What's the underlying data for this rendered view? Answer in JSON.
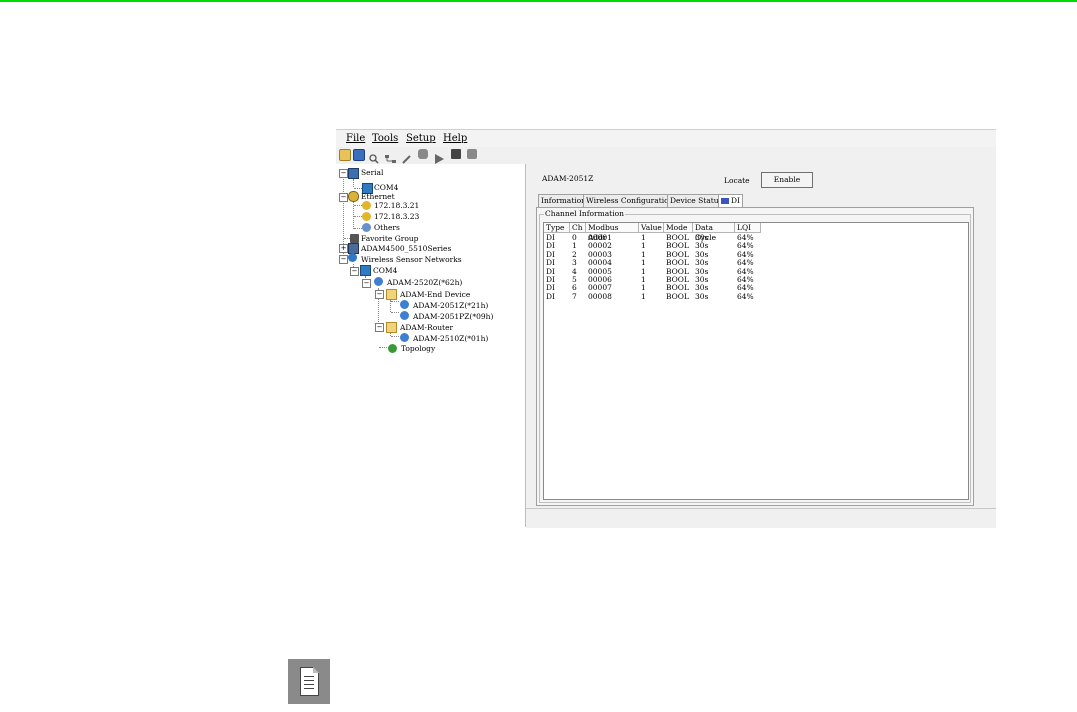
{
  "colors": {
    "top_rule": "#00dd00",
    "tree_connector": "#888888",
    "window_bg": "#f0f0f0"
  },
  "menu": [
    "File",
    "Tools",
    "Setup",
    "Help"
  ],
  "toolbar_icons": [
    "open-icon",
    "save-icon",
    "search-icon",
    "network-icon",
    "wrench-icon",
    "shield-icon",
    "play-icon",
    "camera-icon",
    "monitor-icon"
  ],
  "tree": {
    "serial": "Serial",
    "serial_com": "COM4",
    "ethernet": "Ethernet",
    "ip1": "172.18.3.21",
    "ip2": "172.18.3.23",
    "others": "Others",
    "favorite": "Favorite Group",
    "adam4500": "ADAM4500_5510Series",
    "wsn": "Wireless Sensor Networks",
    "wsn_com": "COM4",
    "coordinator": "ADAM-2520Z(*62h)",
    "end_device": "ADAM-End Device",
    "dev1": "ADAM-2051Z(*21h)",
    "dev2": "ADAM-2051PZ(*09h)",
    "router": "ADAM-Router",
    "dev3": "ADAM-2510Z(*01h)",
    "topology": "Topology"
  },
  "device": {
    "name": "ADAM-2051Z",
    "locate_label": "Locate",
    "enable_label": "Enable"
  },
  "tabs": [
    "Information",
    "Wireless Configuration",
    "Device Status",
    "DI"
  ],
  "group_title": "Channel Information",
  "table": {
    "columns": [
      "Type",
      "Ch",
      "Modbus Addr",
      "Value",
      "Mode",
      "Data Cycle",
      "LQI"
    ],
    "rows": [
      [
        "DI",
        "0",
        "00001",
        "1",
        "BOOL",
        "30s",
        "64%"
      ],
      [
        "DI",
        "1",
        "00002",
        "1",
        "BOOL",
        "30s",
        "64%"
      ],
      [
        "DI",
        "2",
        "00003",
        "1",
        "BOOL",
        "30s",
        "64%"
      ],
      [
        "DI",
        "3",
        "00004",
        "1",
        "BOOL",
        "30s",
        "64%"
      ],
      [
        "DI",
        "4",
        "00005",
        "1",
        "BOOL",
        "30s",
        "64%"
      ],
      [
        "DI",
        "5",
        "00006",
        "1",
        "BOOL",
        "30s",
        "64%"
      ],
      [
        "DI",
        "6",
        "00007",
        "1",
        "BOOL",
        "30s",
        "64%"
      ],
      [
        "DI",
        "7",
        "00008",
        "1",
        "BOOL",
        "30s",
        "64%"
      ]
    ]
  }
}
